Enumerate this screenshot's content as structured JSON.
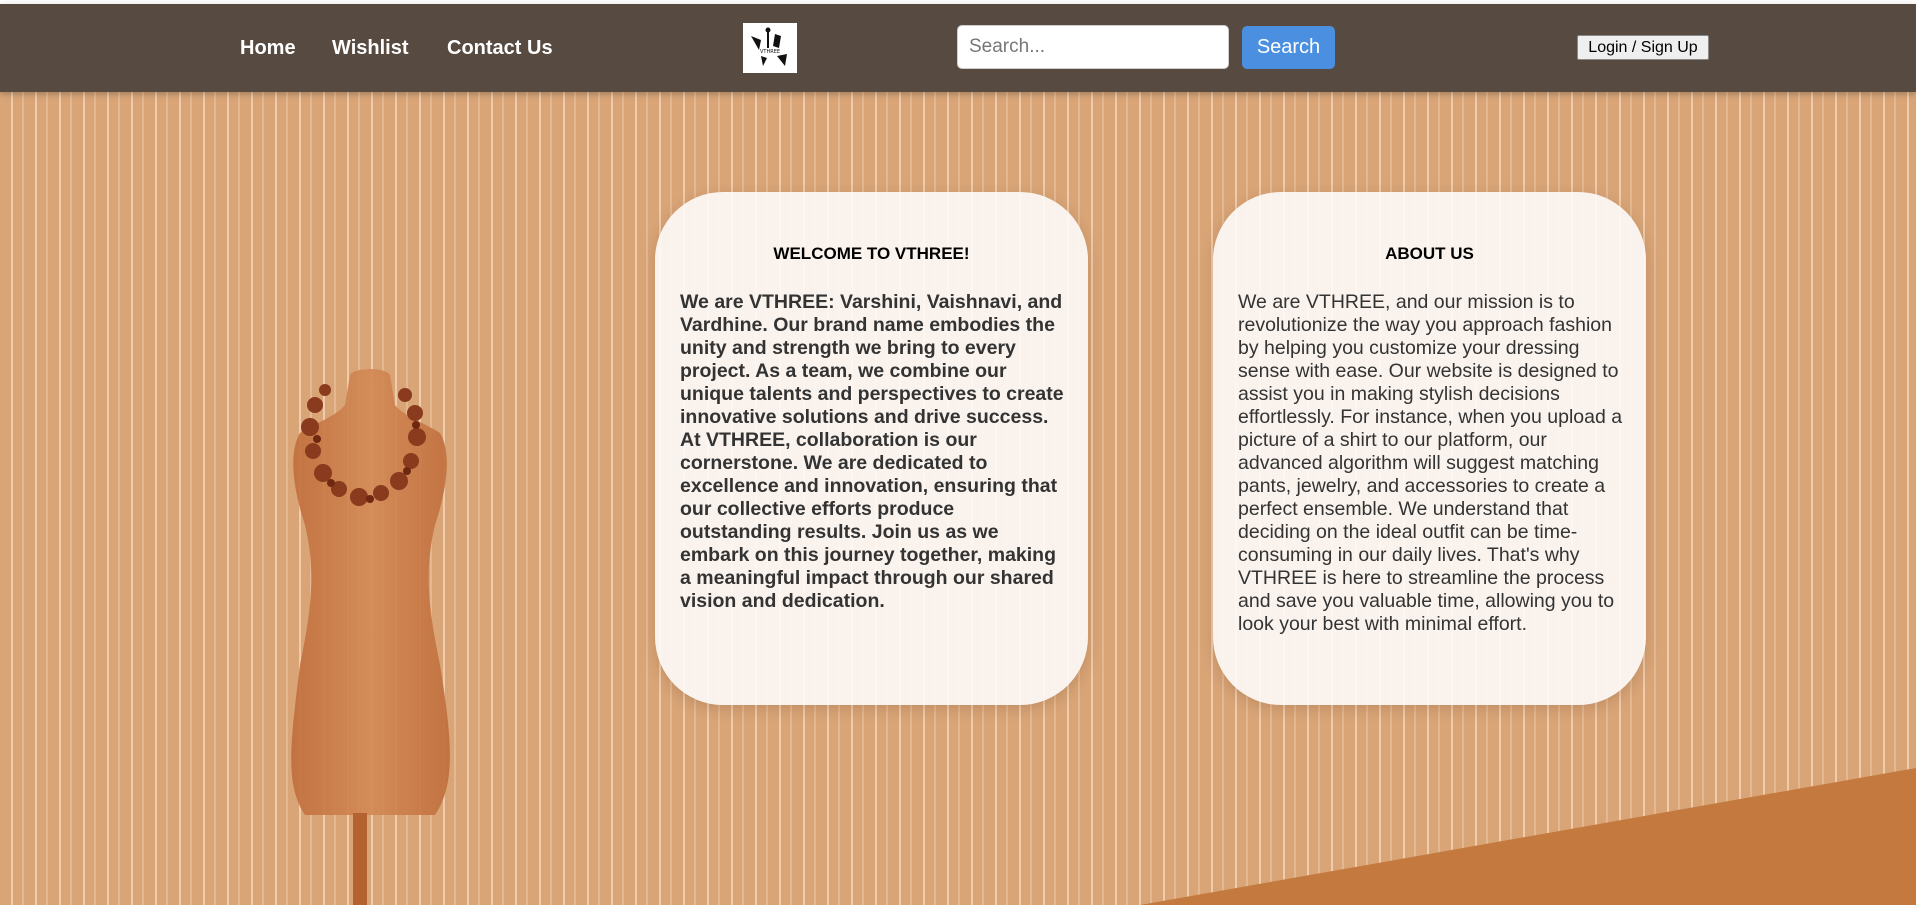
{
  "nav": {
    "links": [
      {
        "label": "Home"
      },
      {
        "label": "Wishlist"
      },
      {
        "label": "Contact Us"
      }
    ],
    "logo": {
      "text": "VTHREE"
    },
    "search": {
      "placeholder": "Search...",
      "value": "",
      "button_label": "Search"
    },
    "login_label": "Login / Sign Up"
  },
  "welcome": {
    "title": "WELCOME TO VTHREE!",
    "body": "We are VTHREE: Varshini, Vaishnavi, and Vardhine. Our brand name embodies the unity and strength we bring to every project. As a team, we combine our unique talents and perspectives to create innovative solutions and drive success. At VTHREE, collaboration is our cornerstone. We are dedicated to excellence and innovation, ensuring that our collective efforts produce outstanding results. Join us as we embark on this journey together, making a meaningful impact through our shared vision and dedication."
  },
  "about": {
    "title": "ABOUT US",
    "body": "We are VTHREE, and our mission is to revolutionize the way you approach fashion by helping you customize your dressing sense with ease. Our website is designed to assist you in making stylish decisions effortlessly. For instance, when you upload a picture of a shirt to our platform, our advanced algorithm will suggest matching pants, jewelry, and accessories to create a perfect ensemble. We understand that deciding on the ideal outfit can be time-consuming in our daily lives. That's why VTHREE is here to streamline the process and save you valuable time, allowing you to look your best with minimal effort."
  },
  "colors": {
    "navbar": "#574a40",
    "background": "#d9a577",
    "accent": "#4a8fe0",
    "mannequin": "#c97a45"
  }
}
